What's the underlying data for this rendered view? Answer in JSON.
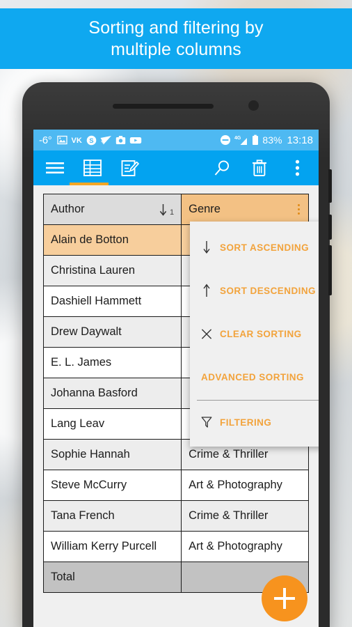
{
  "banner": {
    "line1": "Sorting and filtering by",
    "line2": "multiple columns",
    "bg_color": "#0FA8F0"
  },
  "statusbar": {
    "temperature": "-6°",
    "icons": [
      "gallery-icon",
      "vk-icon",
      "skype-icon",
      "send-icon",
      "camera-icon",
      "youtube-icon"
    ],
    "right_icons": [
      "do-not-disturb-icon",
      "signal-4g-icon",
      "battery-icon"
    ],
    "battery_percent": "83%",
    "clock": "13:18",
    "bg_color": "#4EB9F2"
  },
  "appbar": {
    "bg_color": "#03A3F0",
    "left_icons": [
      {
        "name": "hamburger-menu-icon",
        "label": "Menu"
      },
      {
        "name": "table-view-icon",
        "label": "Table"
      },
      {
        "name": "edit-note-icon",
        "label": "Edit"
      }
    ],
    "right_icons": [
      {
        "name": "search-icon",
        "label": "Search"
      },
      {
        "name": "trash-icon",
        "label": "Delete"
      },
      {
        "name": "overflow-menu-icon",
        "label": "More options"
      }
    ],
    "active_tab_color": "#F5A623"
  },
  "table": {
    "columns": [
      {
        "label": "Author",
        "sorted": true,
        "sort_direction": "down",
        "sort_priority": "1",
        "bg_color": "#DCDCDC"
      },
      {
        "label": "Genre",
        "selected": true,
        "bg_color": "#F3C184"
      }
    ],
    "rows": [
      {
        "author": "Alain de Botton",
        "genre": "",
        "style": "sel"
      },
      {
        "author": "Christina Lauren",
        "genre": "",
        "style": "alt"
      },
      {
        "author": "Dashiell Hammett",
        "genre": "",
        "style": "norm"
      },
      {
        "author": "Drew Daywalt",
        "genre": "",
        "style": "alt"
      },
      {
        "author": "E. L. James",
        "genre": "",
        "style": "norm"
      },
      {
        "author": "Johanna Basford",
        "genre": "",
        "style": "alt"
      },
      {
        "author": "Lang Leav",
        "genre": "",
        "style": "norm"
      },
      {
        "author": "Sophie Hannah",
        "genre": "Crime & Thriller",
        "style": "alt"
      },
      {
        "author": "Steve McCurry",
        "genre": "Art & Photography",
        "style": "norm"
      },
      {
        "author": "Tana French",
        "genre": "Crime & Thriller",
        "style": "alt"
      },
      {
        "author": "William Kerry Purcell",
        "genre": "Art & Photography",
        "style": "norm"
      }
    ],
    "total_row": {
      "author": "Total",
      "genre": "",
      "bg_color": "#C2C2C2"
    }
  },
  "dropdown": {
    "bg_color": "#F0F0F0",
    "text_color": "#F2A33C",
    "items": [
      {
        "label": "SORT ASCENDING",
        "icon": "arrow-down-icon"
      },
      {
        "label": "SORT DESCENDING",
        "icon": "arrow-up-icon"
      },
      {
        "label": "CLEAR SORTING",
        "icon": "close-x-icon"
      },
      {
        "label": "ADVANCED SORTING",
        "icon": ""
      }
    ],
    "footer_items": [
      {
        "label": "FILTERING",
        "icon": "funnel-filter-icon"
      }
    ]
  },
  "fab": {
    "icon": "plus-icon",
    "label": "Add record",
    "color": "#F7931E"
  }
}
